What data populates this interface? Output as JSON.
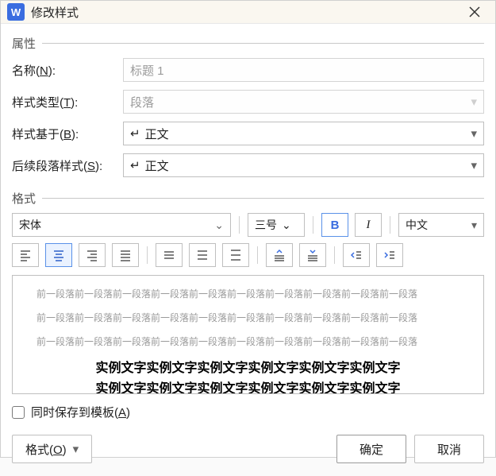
{
  "titlebar": {
    "app_letter": "W",
    "title": "修改样式"
  },
  "sections": {
    "attributes": "属性",
    "format": "格式"
  },
  "labels": {
    "name_pre": "名称(",
    "name_u": "N",
    "name_post": "):",
    "styletype_pre": "样式类型(",
    "styletype_u": "T",
    "styletype_post": "):",
    "basedon_pre": "样式基于(",
    "basedon_u": "B",
    "basedon_post": "):",
    "following_pre": "后续段落样式(",
    "following_u": "S",
    "following_post": "):"
  },
  "values": {
    "name": "标题 1",
    "styletype": "段落",
    "basedon": "正文",
    "following": "正文",
    "font_name": "宋体",
    "font_size": "三号",
    "bold_style": "B",
    "italic_style": "I",
    "language": "中文"
  },
  "preview": {
    "context_line": "前一段落前一段落前一段落前一段落前一段落前一段落前一段落前一段落前一段落前一段落",
    "sample_line": "实例文字实例文字实例文字实例文字实例文字实例文字"
  },
  "save_template": {
    "pre": "同时保存到模板(",
    "u": "A",
    "post": ")"
  },
  "buttons": {
    "format_pre": "格式(",
    "format_u": "O",
    "format_post": ")",
    "ok": "确定",
    "cancel": "取消"
  }
}
